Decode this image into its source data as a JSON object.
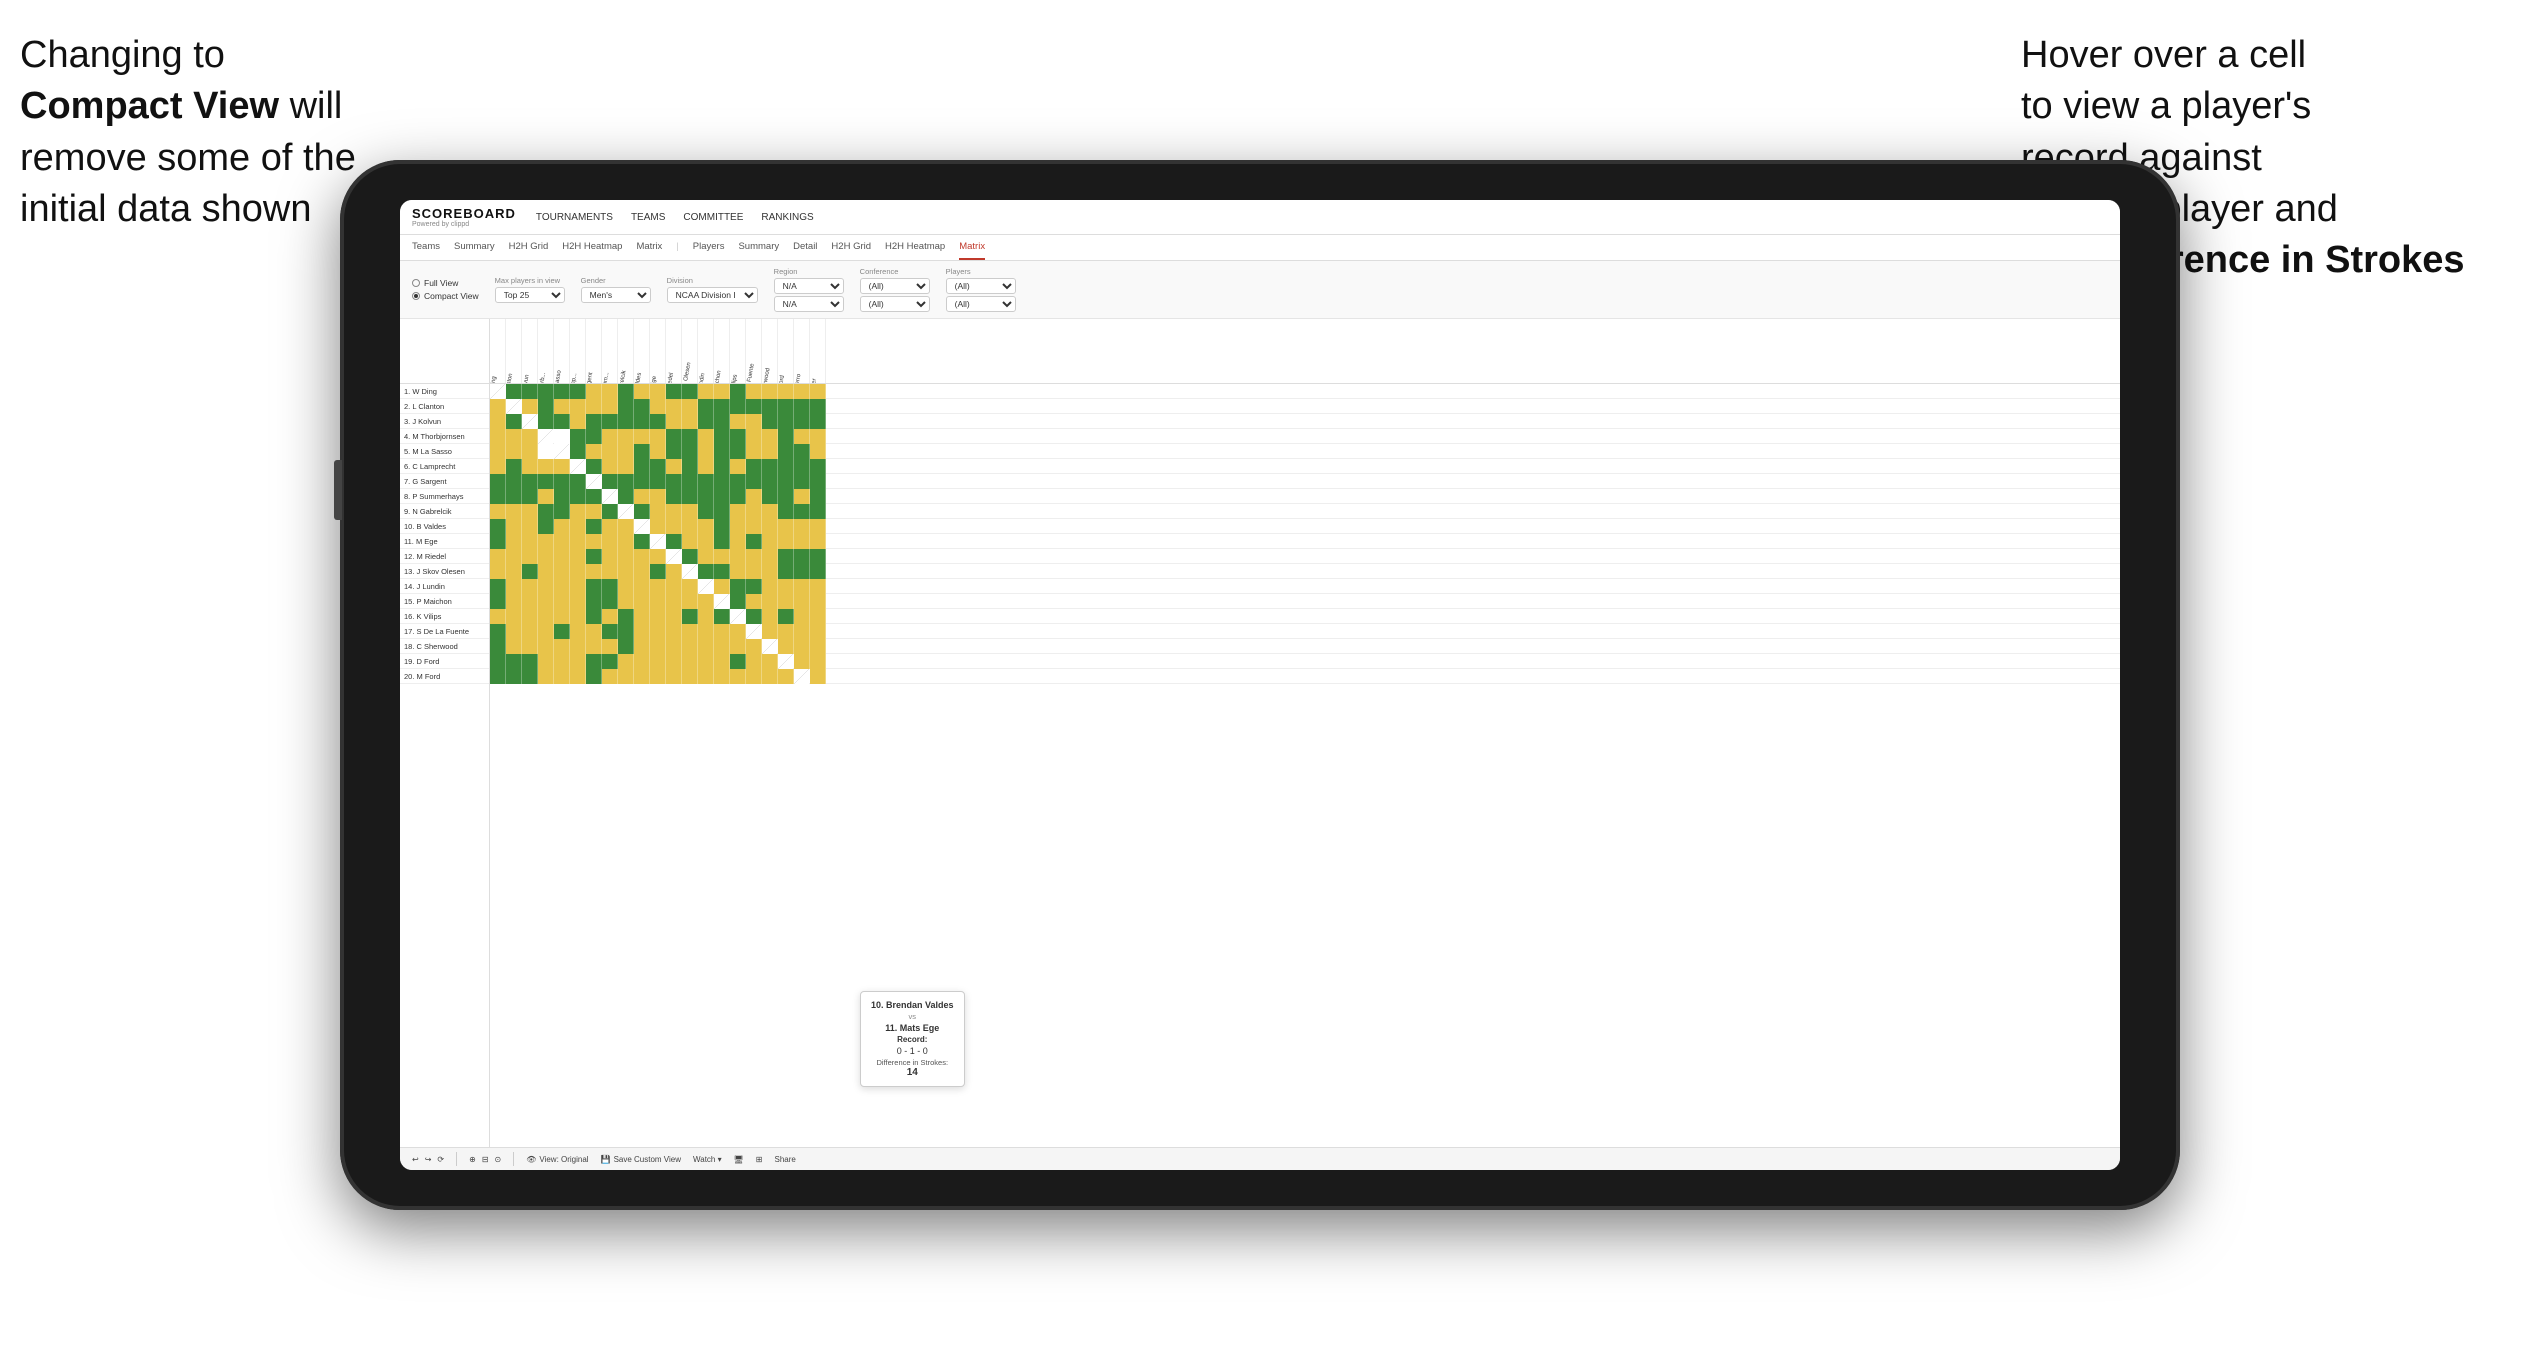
{
  "annotations": {
    "left_text_part1": "Changing to",
    "left_text_bold": "Compact View",
    "left_text_part2": "will remove some of the initial data shown",
    "right_text_part1": "Hover over a cell to view a player's record against another player and the",
    "right_text_bold": "Difference in Strokes"
  },
  "app": {
    "logo": "SCOREBOARD",
    "logo_sub": "Powered by clippd",
    "nav_items": [
      "TOURNAMENTS",
      "TEAMS",
      "COMMITTEE",
      "RANKINGS"
    ],
    "sub_nav": [
      "Teams",
      "Summary",
      "H2H Grid",
      "H2H Heatmap",
      "Matrix",
      "Players",
      "Summary",
      "Detail",
      "H2H Grid",
      "H2H Heatmap",
      "Matrix"
    ],
    "active_sub_nav": "Matrix",
    "view_options": {
      "full_view": "Full View",
      "compact_view": "Compact View",
      "selected": "compact"
    },
    "filters": {
      "max_players_label": "Max players in view",
      "max_players_value": "Top 25",
      "gender_label": "Gender",
      "gender_value": "Men's",
      "division_label": "Division",
      "division_value": "NCAA Division I",
      "region_label": "Region",
      "region_value": "N/A",
      "region_value2": "N/A",
      "conference_label": "Conference",
      "conference_value": "(All)",
      "conference_value2": "(All)",
      "players_label": "Players",
      "players_value": "(All)",
      "players_value2": "(All)"
    },
    "row_players": [
      "1. W Ding",
      "2. L Clanton",
      "3. J Kolvun",
      "4. M Thorbjornsen",
      "5. M La Sasso",
      "6. C Lamprecht",
      "7. G Sargent",
      "8. P Summerhays",
      "9. N Gabrelcik",
      "10. B Valdes",
      "11. M Ege",
      "12. M Riedel",
      "13. J Skov Olesen",
      "14. J Lundin",
      "15. P Maichon",
      "16. K Vilips",
      "17. S De La Fuente",
      "18. C Sherwood",
      "19. D Ford",
      "20. M Ford"
    ],
    "col_players": [
      "1. W Ding",
      "2. L Clanton",
      "3. J Kolvun",
      "4. M Thorbjornsen",
      "5. M La Sasso",
      "6. C Lamprecht",
      "7. G Sargent",
      "8. P Summerhays",
      "9. N Gabrelcik",
      "10. B Valdes",
      "11. M Ege",
      "12. M Riedel",
      "13. J Jensen Olesen",
      "14. J Lundin",
      "15. P Maichon",
      "16. K Vilips",
      "17. S De La Fuente",
      "18. C Sherwood",
      "19. D Ford",
      "20. M Ferro",
      "Greaser"
    ],
    "tooltip": {
      "player1": "10. Brendan Valdes",
      "vs": "vs",
      "player2": "11. Mats Ege",
      "record_label": "Record:",
      "record": "0 - 1 - 0",
      "diff_label": "Difference in Strokes:",
      "diff_value": "14"
    },
    "toolbar": {
      "undo": "↩",
      "redo": "↪",
      "history": "⟳",
      "view_original": "View: Original",
      "save_custom": "Save Custom View",
      "watch": "Watch ▾",
      "share": "Share"
    }
  }
}
